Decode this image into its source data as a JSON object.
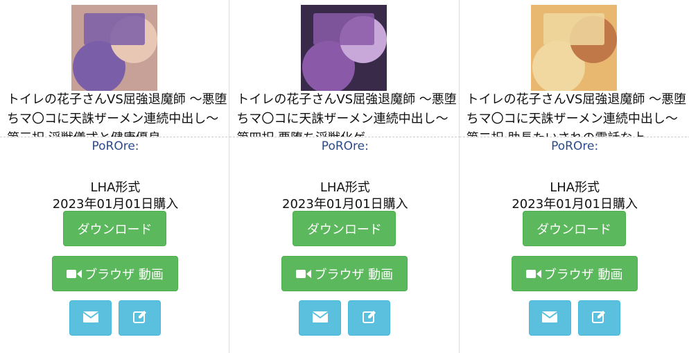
{
  "items": [
    {
      "title": "トイレの花子さんVS屈強退魔師 〜悪堕ちマ〇コに天誅ザーメン連続中出し〜第三択 淫獣儀式と健康優良",
      "circle": "PoROre:",
      "format": "LHA形式",
      "purchase_date": "2023年01月01日購入",
      "download_label": "ダウンロード",
      "video_label": "ブラウザ 動画",
      "palette": [
        "#c7a097",
        "#7b5ea8",
        "#e9c7b5"
      ]
    },
    {
      "title": "トイレの花子さんVS屈強退魔師 〜悪堕ちマ〇コに天誅ザーメン連続中出し〜第四択 悪堕ち淫獣化ゲ",
      "circle": "PoROre:",
      "format": "LHA形式",
      "purchase_date": "2023年01月01日購入",
      "download_label": "ダウンロード",
      "video_label": "ブラウザ 動画",
      "palette": [
        "#3a2a4a",
        "#8a5aa8",
        "#c8a8d8"
      ]
    },
    {
      "title": "トイレの花子さんVS屈強退魔師 〜悪堕ちマ〇コに天誅ザーメン連続中出し〜第二択 助長たいされの電話な上",
      "circle": "PoROre:",
      "format": "LHA形式",
      "purchase_date": "2023年01月01日購入",
      "download_label": "ダウンロード",
      "video_label": "ブラウザ 動画",
      "palette": [
        "#e8b870",
        "#f0d8a0",
        "#c07848"
      ]
    }
  ],
  "icons": {
    "video": "video-camera-icon",
    "mail": "envelope-icon",
    "edit": "edit-icon"
  },
  "colors": {
    "green_button": "#5cb85c",
    "blue_button": "#5bc0de",
    "circle_text": "#2a4a8a"
  }
}
